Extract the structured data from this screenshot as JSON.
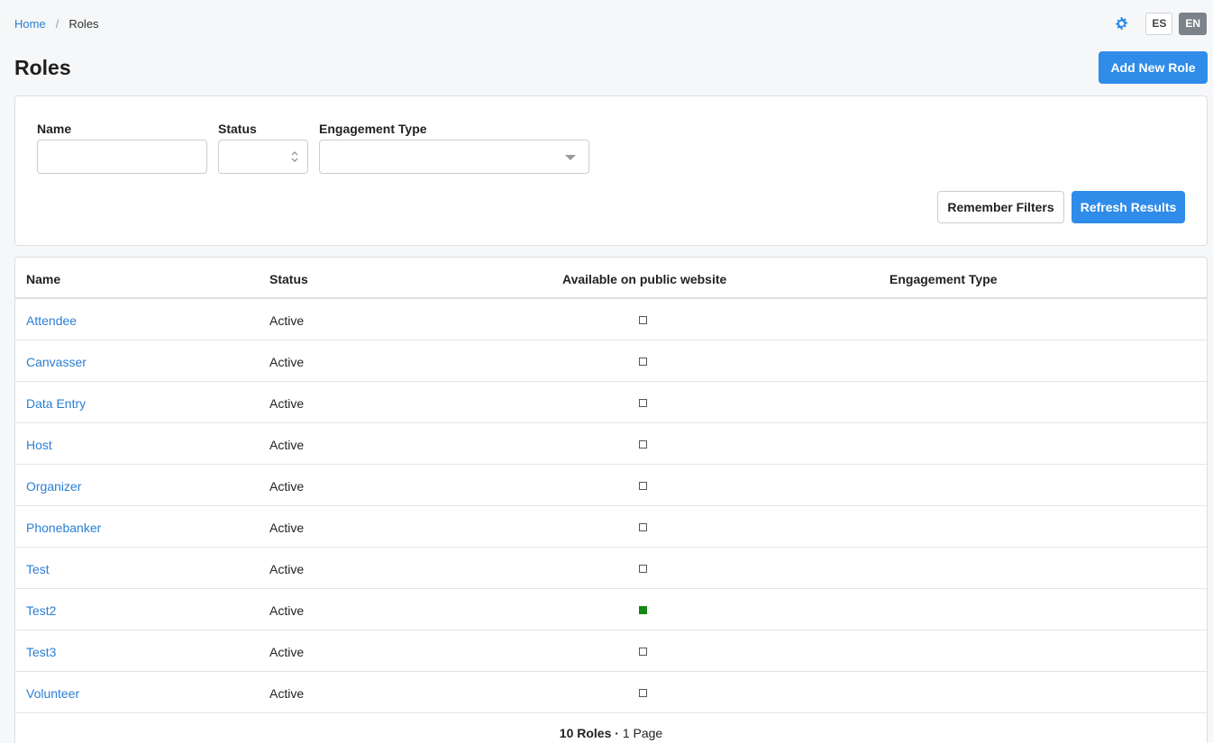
{
  "breadcrumb": {
    "home": "Home",
    "separator": "/",
    "current": "Roles"
  },
  "top_actions": {
    "settings_icon": "gear-icon",
    "lang_es": "ES",
    "lang_en": "EN",
    "active_lang": "EN"
  },
  "page": {
    "title": "Roles",
    "add_button": "Add New Role"
  },
  "filters": {
    "name_label": "Name",
    "name_value": "",
    "status_label": "Status",
    "status_value": "",
    "engagement_label": "Engagement Type",
    "engagement_value": "",
    "remember_button": "Remember Filters",
    "refresh_button": "Refresh Results"
  },
  "table": {
    "columns": [
      "Name",
      "Status",
      "Available on public website",
      "Engagement Type"
    ],
    "rows": [
      {
        "name": "Attendee",
        "status": "Active",
        "public": false,
        "engagement": ""
      },
      {
        "name": "Canvasser",
        "status": "Active",
        "public": false,
        "engagement": ""
      },
      {
        "name": "Data Entry",
        "status": "Active",
        "public": false,
        "engagement": ""
      },
      {
        "name": "Host",
        "status": "Active",
        "public": false,
        "engagement": ""
      },
      {
        "name": "Organizer",
        "status": "Active",
        "public": false,
        "engagement": ""
      },
      {
        "name": "Phonebanker",
        "status": "Active",
        "public": false,
        "engagement": ""
      },
      {
        "name": "Test",
        "status": "Active",
        "public": false,
        "engagement": ""
      },
      {
        "name": "Test2",
        "status": "Active",
        "public": true,
        "engagement": ""
      },
      {
        "name": "Test3",
        "status": "Active",
        "public": false,
        "engagement": ""
      },
      {
        "name": "Volunteer",
        "status": "Active",
        "public": false,
        "engagement": ""
      }
    ]
  },
  "summary": {
    "count": "10 Roles",
    "separator": "·",
    "pages": "1 Page"
  },
  "colors": {
    "accent": "#2f8ce8",
    "link": "#2b7fd4",
    "checked": "#138a13"
  }
}
